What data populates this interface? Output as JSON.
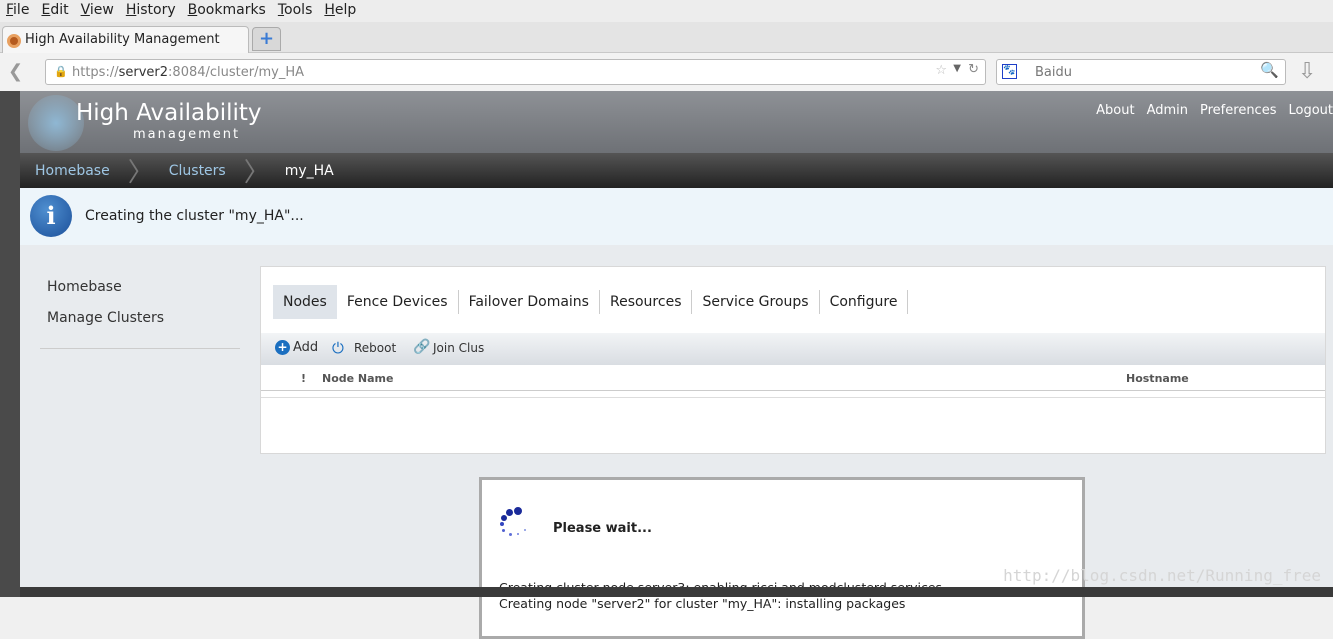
{
  "menu": [
    "File",
    "Edit",
    "View",
    "History",
    "Bookmarks",
    "Tools",
    "Help"
  ],
  "browser": {
    "tab_title": "High Availability Management",
    "url_host": "https://",
    "url_server": "server2",
    "url_path": ":8084/cluster/my_HA",
    "search_placeholder": "Baidu"
  },
  "app": {
    "logo_title": "High Availability",
    "logo_sub": "management",
    "toplinks": [
      "About",
      "Admin",
      "Preferences",
      "Logout"
    ]
  },
  "breadcrumb": [
    "Homebase",
    "Clusters",
    "my_HA"
  ],
  "info_message": "Creating the cluster \"my_HA\"...",
  "sidebar": [
    "Homebase",
    "Manage Clusters"
  ],
  "tabs": [
    "Nodes",
    "Fence Devices",
    "Failover Domains",
    "Resources",
    "Service Groups",
    "Configure"
  ],
  "toolbar": {
    "add": "Add",
    "reboot": "Reboot",
    "join": "Join Clus"
  },
  "table": {
    "col_status": "!",
    "col_node": "Node Name",
    "col_host": "Hostname"
  },
  "modal": {
    "title": "Please wait...",
    "lines": [
      "Creating cluster node server3: enabling ricci and modclusterd services",
      "Creating node \"server2\" for cluster \"my_HA\": installing packages"
    ]
  },
  "watermark": "http://blog.csdn.net/Running_free"
}
